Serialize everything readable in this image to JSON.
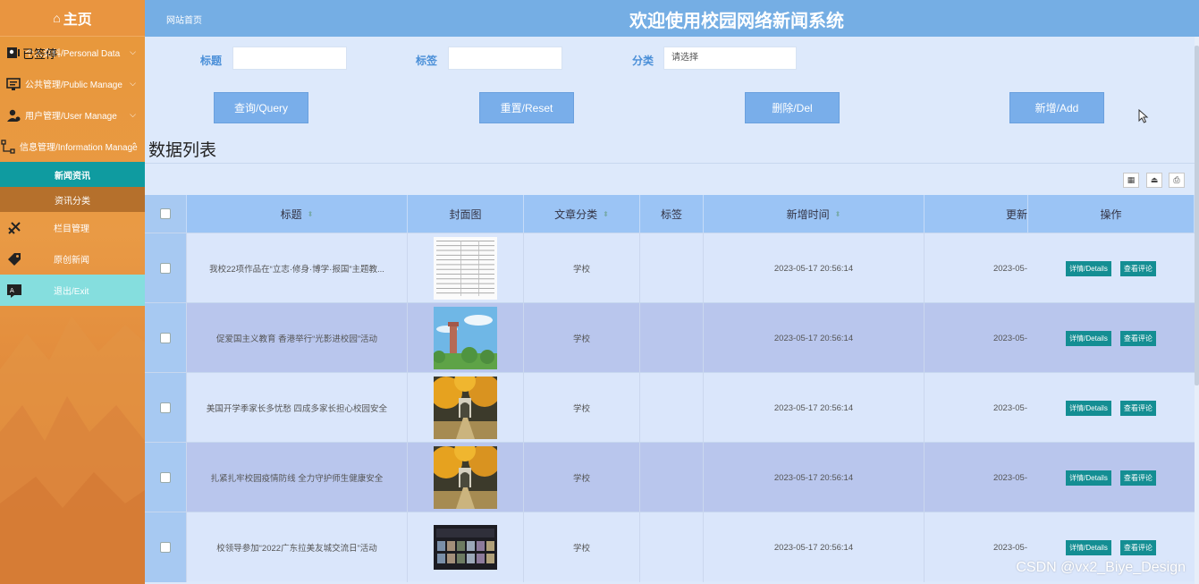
{
  "sidebar": {
    "brand": "主页",
    "menu": [
      {
        "label": "个人资料/Personal Data",
        "icon": "personal-icon"
      },
      {
        "label": "公共管理/Public Manage",
        "icon": "public-icon"
      },
      {
        "label": "用户管理/User Manage",
        "icon": "user-icon"
      },
      {
        "label": "信息管理/Information Manage",
        "icon": "info-icon"
      }
    ],
    "overlay_text": "已签停",
    "submenu": [
      {
        "label": "新闻资讯"
      },
      {
        "label": "资讯分类"
      }
    ],
    "menu2": [
      {
        "label": "栏目管理",
        "icon": "column-icon"
      },
      {
        "label": "原创新闻",
        "icon": "tag-icon"
      },
      {
        "label": "退出/Exit",
        "icon": "exit-icon"
      }
    ]
  },
  "header": {
    "breadcrumb": "网站首页",
    "title": "欢迎使用校园网络新闻系统"
  },
  "filters": {
    "title_label": "标题",
    "tag_label": "标签",
    "category_label": "分类",
    "category_placeholder": "请选择"
  },
  "actions": {
    "query": "查询/Query",
    "reset": "重置/Reset",
    "delete": "删除/Del",
    "add": "新增/Add"
  },
  "section_title": "数据列表",
  "table": {
    "headers": {
      "title": "标题",
      "cover": "封面图",
      "category": "文章分类",
      "tags": "标签",
      "created": "新增时间",
      "updated": "更新",
      "ops": "操作"
    },
    "rows": [
      {
        "title": "我校22项作品在“立志·修身·博学·报国”主题教...",
        "category": "学校",
        "created": "2023-05-17 20:56:14",
        "updated": "2023-05-",
        "cover": "document"
      },
      {
        "title": "促爱国主义教育 香港举行“光影进校园”活动",
        "category": "学校",
        "created": "2023-05-17 20:56:14",
        "updated": "2023-05-",
        "cover": "tower"
      },
      {
        "title": "美国开学季家长多忧愁 四成多家长担心校园安全",
        "category": "学校",
        "created": "2023-05-17 20:56:14",
        "updated": "2023-05-",
        "cover": "autumn"
      },
      {
        "title": "扎紧扎牢校园疫情防线 全力守护师生健康安全",
        "category": "学校",
        "created": "2023-05-17 20:56:14",
        "updated": "2023-05-",
        "cover": "autumn"
      },
      {
        "title": "校领导参加“2022广东拉美友城交流日”活动",
        "category": "学校",
        "created": "2023-05-17 20:56:14",
        "updated": "2023-05-",
        "cover": "meeting"
      }
    ],
    "details_label": "详情/Details",
    "comments_label": "查看评论"
  },
  "watermark": "CSDN @vx2_Biye_Design",
  "colors": {
    "sidebar": "#e99a45",
    "header": "#75aee4",
    "main_bg": "#dde9fb",
    "op_button": "#148e93",
    "table_head": "#9bc4f5"
  }
}
